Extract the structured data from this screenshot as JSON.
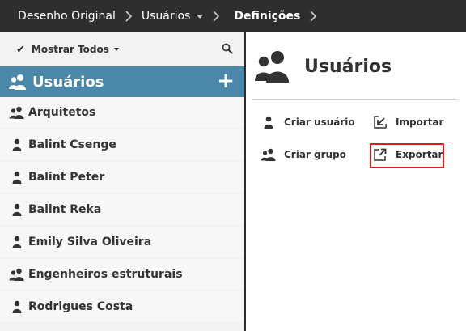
{
  "breadcrumb": {
    "items": [
      {
        "label": "Desenho Original"
      },
      {
        "label": "Usuários"
      },
      {
        "label": "Definições"
      }
    ]
  },
  "filter": {
    "label": "Mostrar Todos"
  },
  "group": {
    "title": "Usuários"
  },
  "users": [
    {
      "name": "Arquitetos",
      "type": "group"
    },
    {
      "name": "Balint Csenge",
      "type": "user"
    },
    {
      "name": "Balint Peter",
      "type": "user"
    },
    {
      "name": "Balint Reka",
      "type": "user"
    },
    {
      "name": "Emily Silva Oliveira",
      "type": "user"
    },
    {
      "name": "Engenheiros estruturais",
      "type": "group"
    },
    {
      "name": "Rodrigues Costa",
      "type": "user"
    }
  ],
  "panel": {
    "title": "Usuários",
    "actions": {
      "create_user": "Criar usuário",
      "import": "Importar",
      "create_group": "Criar grupo",
      "export": "Exportar"
    }
  },
  "colors": {
    "topbar": "#2e2e2e",
    "accent": "#4a87a8",
    "highlight": "#e01a1a"
  }
}
